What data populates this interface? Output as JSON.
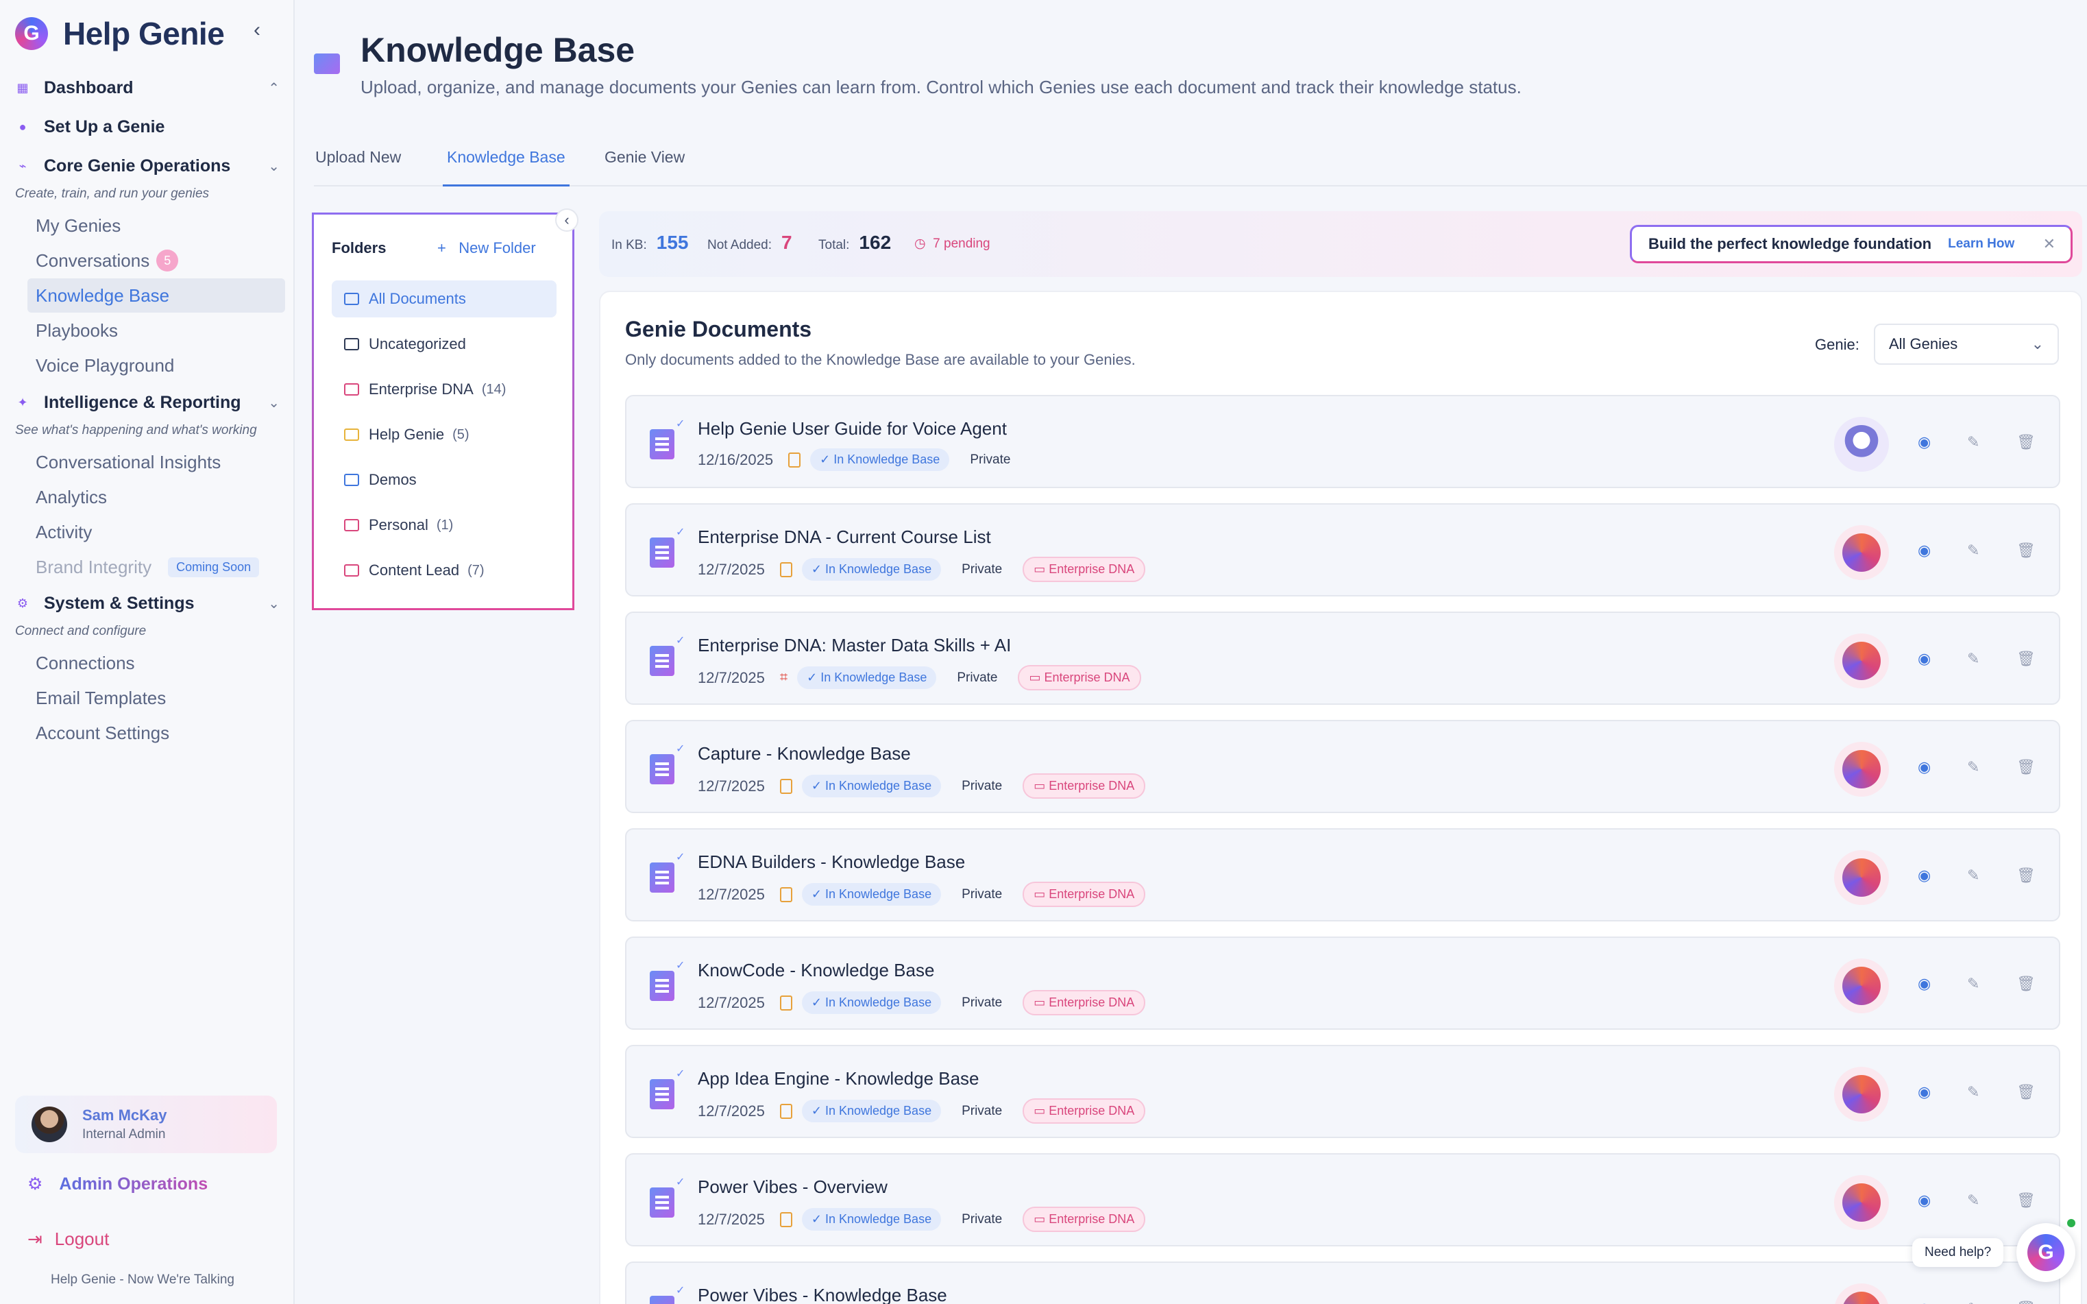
{
  "app": {
    "name": "Help Genie",
    "logo_letter": "G",
    "tagline": "Help Genie - Now We're Talking"
  },
  "sidebar": {
    "dashboard": "Dashboard",
    "setup": "Set Up a Genie",
    "core": {
      "label": "Core Genie Operations",
      "sub": "Create, train, and run your genies"
    },
    "core_items": [
      {
        "label": "My Genies"
      },
      {
        "label": "Conversations",
        "badge": "5"
      },
      {
        "label": "Knowledge Base"
      },
      {
        "label": "Playbooks"
      },
      {
        "label": "Voice Playground"
      }
    ],
    "intel": {
      "label": "Intelligence & Reporting",
      "sub": "See what's happening and what's working"
    },
    "intel_items": [
      {
        "label": "Conversational Insights"
      },
      {
        "label": "Analytics"
      },
      {
        "label": "Activity"
      },
      {
        "label": "Brand Integrity",
        "badge": "Coming Soon"
      }
    ],
    "system": {
      "label": "System & Settings",
      "sub": "Connect and configure"
    },
    "system_items": [
      {
        "label": "Connections"
      },
      {
        "label": "Email Templates"
      },
      {
        "label": "Account Settings"
      }
    ],
    "user": {
      "name": "Sam McKay",
      "role": "Internal Admin"
    },
    "admin_ops": "Admin Operations",
    "logout": "Logout"
  },
  "header": {
    "title": "Knowledge Base",
    "subtitle": "Upload, organize, and manage documents your Genies can learn from. Control which Genies use each document and track their knowledge status."
  },
  "tabs": [
    "Upload New",
    "Knowledge Base",
    "Genie View"
  ],
  "folders": {
    "title": "Folders",
    "new_folder": "New Folder",
    "items": [
      {
        "label": "All Documents",
        "count": ""
      },
      {
        "label": "Uncategorized",
        "count": ""
      },
      {
        "label": "Enterprise DNA",
        "count": "(14)"
      },
      {
        "label": "Help Genie",
        "count": "(5)"
      },
      {
        "label": "Demos",
        "count": ""
      },
      {
        "label": "Personal",
        "count": "(1)"
      },
      {
        "label": "Content Lead",
        "count": "(7)"
      }
    ]
  },
  "stats": {
    "in_kb_label": "In KB:",
    "in_kb": "155",
    "not_added_label": "Not Added:",
    "not_added": "7",
    "total_label": "Total:",
    "total": "162",
    "pending": "7 pending"
  },
  "promo": {
    "text": "Build the perfect knowledge foundation",
    "link": "Learn How"
  },
  "documents": {
    "title": "Genie Documents",
    "subtitle": "Only documents added to the Knowledge Base are available to your Genies.",
    "genie_label": "Genie:",
    "genie_value": "All Genies",
    "rows": [
      {
        "title": "Help Genie User Guide for Voice Agent",
        "date": "12/16/2025",
        "status": "In Knowledge Base",
        "visibility": "Private",
        "folder": ""
      },
      {
        "title": "Enterprise DNA - Current Course List",
        "date": "12/7/2025",
        "status": "In Knowledge Base",
        "visibility": "Private",
        "folder": "Enterprise DNA"
      },
      {
        "title": "Enterprise DNA: Master Data Skills + AI",
        "date": "12/7/2025",
        "status": "In Knowledge Base",
        "visibility": "Private",
        "folder": "Enterprise DNA"
      },
      {
        "title": "Capture - Knowledge Base",
        "date": "12/7/2025",
        "status": "In Knowledge Base",
        "visibility": "Private",
        "folder": "Enterprise DNA"
      },
      {
        "title": "EDNA Builders - Knowledge Base",
        "date": "12/7/2025",
        "status": "In Knowledge Base",
        "visibility": "Private",
        "folder": "Enterprise DNA"
      },
      {
        "title": "KnowCode - Knowledge Base",
        "date": "12/7/2025",
        "status": "In Knowledge Base",
        "visibility": "Private",
        "folder": "Enterprise DNA"
      },
      {
        "title": "App Idea Engine - Knowledge Base",
        "date": "12/7/2025",
        "status": "In Knowledge Base",
        "visibility": "Private",
        "folder": "Enterprise DNA"
      },
      {
        "title": "Power Vibes - Overview",
        "date": "12/7/2025",
        "status": "In Knowledge Base",
        "visibility": "Private",
        "folder": "Enterprise DNA"
      },
      {
        "title": "Power Vibes - Knowledge Base",
        "date": "",
        "status": "",
        "visibility": "",
        "folder": ""
      }
    ]
  },
  "help": {
    "label": "Need help?",
    "fab_letter": "G"
  }
}
